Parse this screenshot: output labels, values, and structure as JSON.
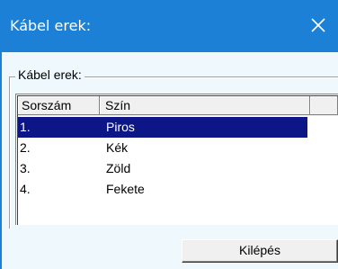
{
  "window": {
    "title": "Kábel erek:",
    "close_icon": "close-icon"
  },
  "group": {
    "legend": "Kábel erek:"
  },
  "list": {
    "columns": [
      "Sorszám",
      "Szín",
      ""
    ],
    "rows": [
      {
        "num": "1.",
        "color": "Piros",
        "selected": true
      },
      {
        "num": "2.",
        "color": "Kék",
        "selected": false
      },
      {
        "num": "3.",
        "color": "Zöld",
        "selected": false
      },
      {
        "num": "4.",
        "color": "Fekete",
        "selected": false
      }
    ]
  },
  "buttons": {
    "exit_label": "Kilépés"
  },
  "colors": {
    "titlebar": "#1b80d6",
    "selection": "#0c1687",
    "client_bg": "#eef8fd"
  }
}
